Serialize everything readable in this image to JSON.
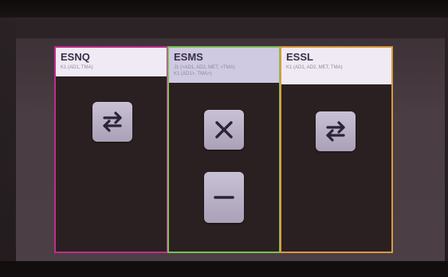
{
  "cards": [
    {
      "title": "ESNQ",
      "subtitle_lines": [
        "K1 (AD1, TMA)"
      ],
      "border_color": "#c02d8d",
      "buttons": [
        "swap-arrows-icon"
      ]
    },
    {
      "title": "ESMS",
      "subtitle_lines": [
        "J1 (>AD1, AD2, MET, >TMA)",
        "K1 (AD1>, TMA>)"
      ],
      "border_color": "#7dbf5a",
      "buttons": [
        "close-x-icon",
        "minus-icon"
      ]
    },
    {
      "title": "ESSL",
      "subtitle_lines": [
        "K1 (AD1, AD2, MET, TMA)"
      ],
      "border_color": "#d99a3e",
      "buttons": [
        "swap-arrows-icon"
      ]
    }
  ],
  "colors": {
    "icon_color": "#2b2436",
    "button_face": "#b9b0c6",
    "header_bg": "#efeaf3"
  }
}
